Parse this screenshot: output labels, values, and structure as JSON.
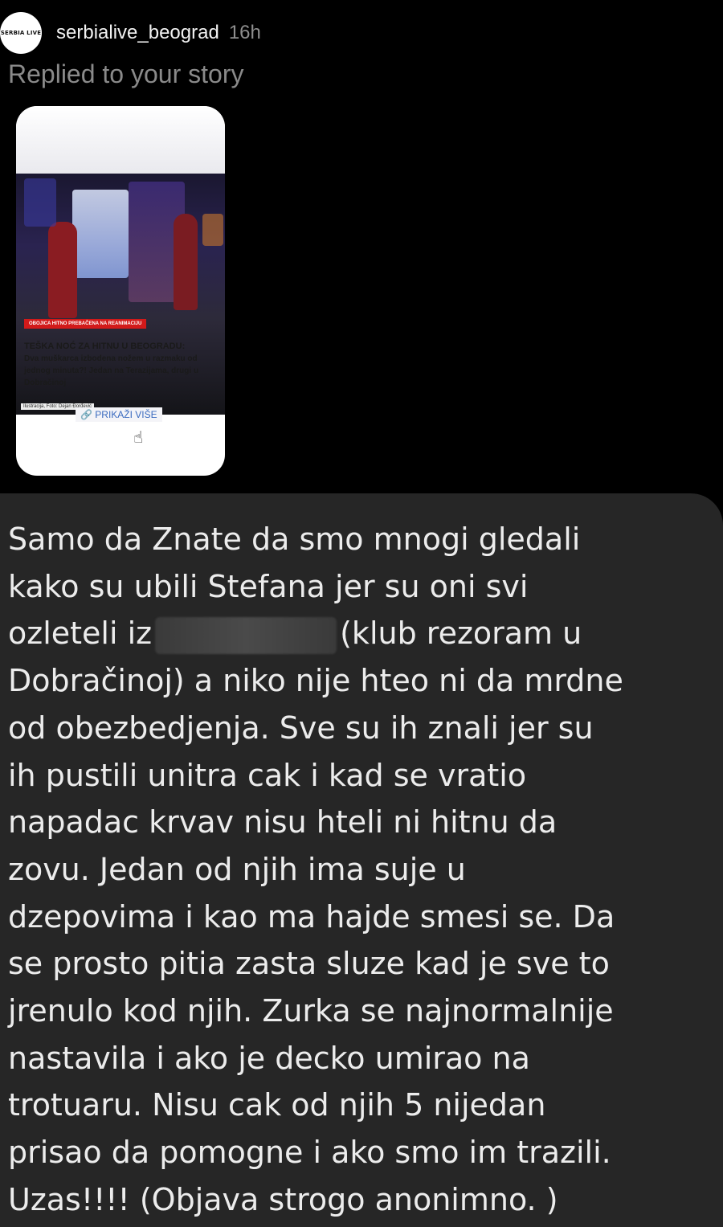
{
  "header": {
    "avatar_text": "SERBIA LIVE",
    "username": "serbialive_beograd",
    "timestamp": "16h"
  },
  "reply_label": "Replied to your story",
  "story": {
    "photo_caption": "Ilustracija, Foto: Dejan Đorđević",
    "tag": "OBOJICA HITNO PREBAČENA NA REANIMACIJU",
    "headline": "TEŠKA NOĆ ZA HITNU U BEOGRADU:",
    "body": "Dva muškarca izbodena nožem u razmaku od jednog minuta?! Jedan na Terazijama, drugi u Dobračinoj",
    "more_label": "🔗 PRIKAŽI VIŠE"
  },
  "message": {
    "lines": [
      "Samo da Znate da smo mnogi gledali",
      "kako su ubili Stefana jer su oni svi",
      "ozleteli iz",
      "(klub rezoram u",
      "Dobračinoj) a niko nije hteo ni da mrdne",
      "od obezbedjenja. Sve su ih znali jer su",
      "ih pustili unitra cak i kad se vratio",
      "napadac krvav nisu hteli ni hitnu da",
      "zovu. Jedan od njih ima suje u",
      "dzepovima i kao ma hajde smesi se. Da",
      "se prosto pitia zasta sluze kad je sve to",
      "jrenulo kod njih. Zurka se najnormalnije",
      "nastavila i ako je decko umirao na",
      "trotuaru. Nisu cak od njih 5 nijedan",
      "prisao da pomogne i ako smo im trazili.",
      "Uzas!!!!  (Objava strogo anonimno. )"
    ]
  }
}
